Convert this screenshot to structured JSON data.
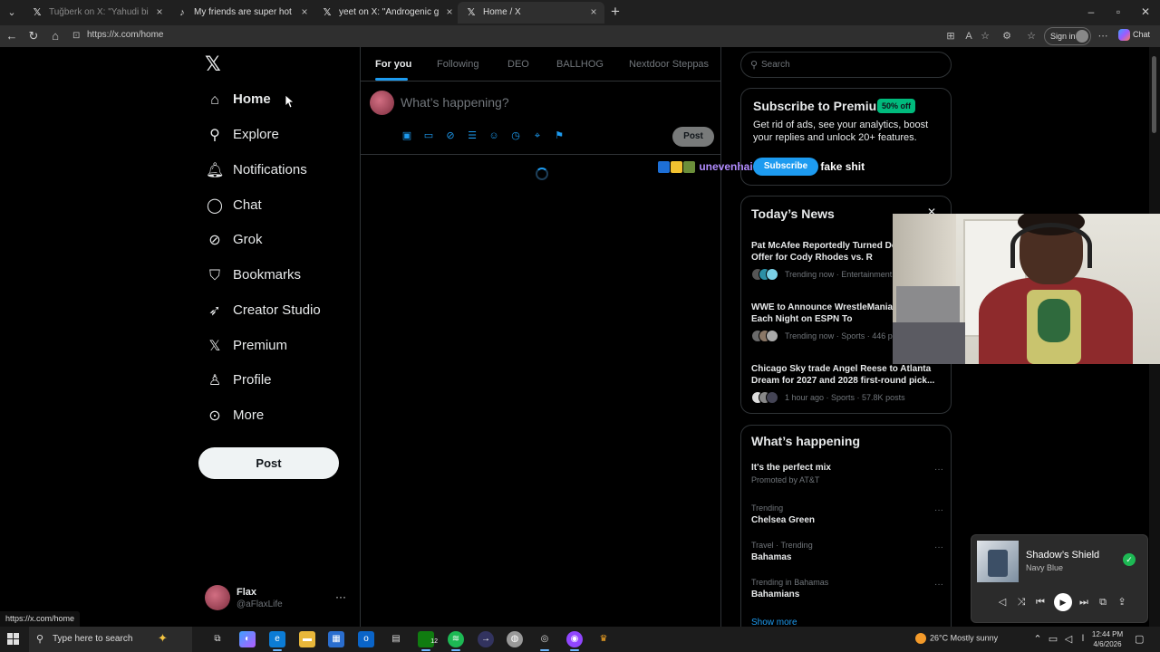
{
  "browser": {
    "tabs": [
      {
        "title": "Tuğberk on X: \"Yahudi bir şahıs, k",
        "favicon": "x-icon"
      },
      {
        "title": "My friends are super hot 🤖😂 #",
        "favicon": "tiktok-icon"
      },
      {
        "title": "yeet on X: \"Androgenic goes throu",
        "favicon": "x-icon"
      },
      {
        "title": "Home / X",
        "favicon": "x-icon"
      }
    ],
    "url": "https://x.com/home",
    "sign_in_label": "Sign in",
    "copilot_label": "Chat",
    "status_link": "https://x.com/home"
  },
  "sidebar": {
    "items": [
      {
        "label": "Home",
        "icon": "home-icon"
      },
      {
        "label": "Explore",
        "icon": "search-icon"
      },
      {
        "label": "Notifications",
        "icon": "bell-icon"
      },
      {
        "label": "Chat",
        "icon": "chat-bubble-icon"
      },
      {
        "label": "Grok",
        "icon": "grok-icon"
      },
      {
        "label": "Bookmarks",
        "icon": "bookmark-icon"
      },
      {
        "label": "Creator Studio",
        "icon": "rocket-icon"
      },
      {
        "label": "Premium",
        "icon": "x-logo-icon"
      },
      {
        "label": "Profile",
        "icon": "person-icon"
      },
      {
        "label": "More",
        "icon": "more-circle-icon"
      }
    ],
    "post_label": "Post",
    "profile": {
      "name": "Flax",
      "handle": "@aFlaxLife"
    }
  },
  "feed": {
    "tabs": [
      "For you",
      "Following",
      "DEO",
      "BALLHOG",
      "Nextdoor Steppas"
    ],
    "active_tab": "For you",
    "composer_placeholder": "What’s happening?",
    "post_label": "Post"
  },
  "overlay_chat": {
    "user": "unevenhairline",
    "message": "get this fake shit"
  },
  "right": {
    "search_placeholder": "Search",
    "premium": {
      "title": "Subscribe to Premium",
      "badge": "50% off",
      "description": "Get rid of ads, see your analytics, boost your replies and unlock 20+ features.",
      "button": "Subscribe"
    },
    "news": {
      "title": "Today’s News",
      "items": [
        {
          "headline": "Pat McAfee Reportedly Turned Down WWE Offer for Cody Rhodes vs. R",
          "meta": "Trending now · Entertainment"
        },
        {
          "headline": "WWE to Announce WrestleMania Lineup for Each Night on ESPN To",
          "meta": "Trending now · Sports · 446 posts"
        },
        {
          "headline": "Chicago Sky trade Angel Reese to Atlanta Dream for 2027 and 2028 first-round pick...",
          "meta": "1 hour ago · Sports · 57.8K posts"
        }
      ]
    },
    "happening": {
      "title": "What’s happening",
      "trends": [
        {
          "context": "",
          "name": "It's the perfect mix",
          "promo": "Promoted by AT&T"
        },
        {
          "context": "Trending",
          "name": "Chelsea Green",
          "promo": ""
        },
        {
          "context": "Travel · Trending",
          "name": "Bahamas",
          "promo": ""
        },
        {
          "context": "Trending in Bahamas",
          "name": "Bahamians",
          "promo": ""
        }
      ],
      "show_more": "Show more"
    }
  },
  "media": {
    "song": "Shadow’s Shield",
    "artist": "Navy Blue"
  },
  "taskbar": {
    "search_placeholder": "Type here to search",
    "xbox_badge": "12",
    "weather": "26°C  Mostly sunny",
    "time": "12:44 PM",
    "date": "4/6/2026"
  },
  "colors": {
    "accent": "#1d9bf0",
    "badge": "#00ba7c",
    "background": "#000000"
  }
}
